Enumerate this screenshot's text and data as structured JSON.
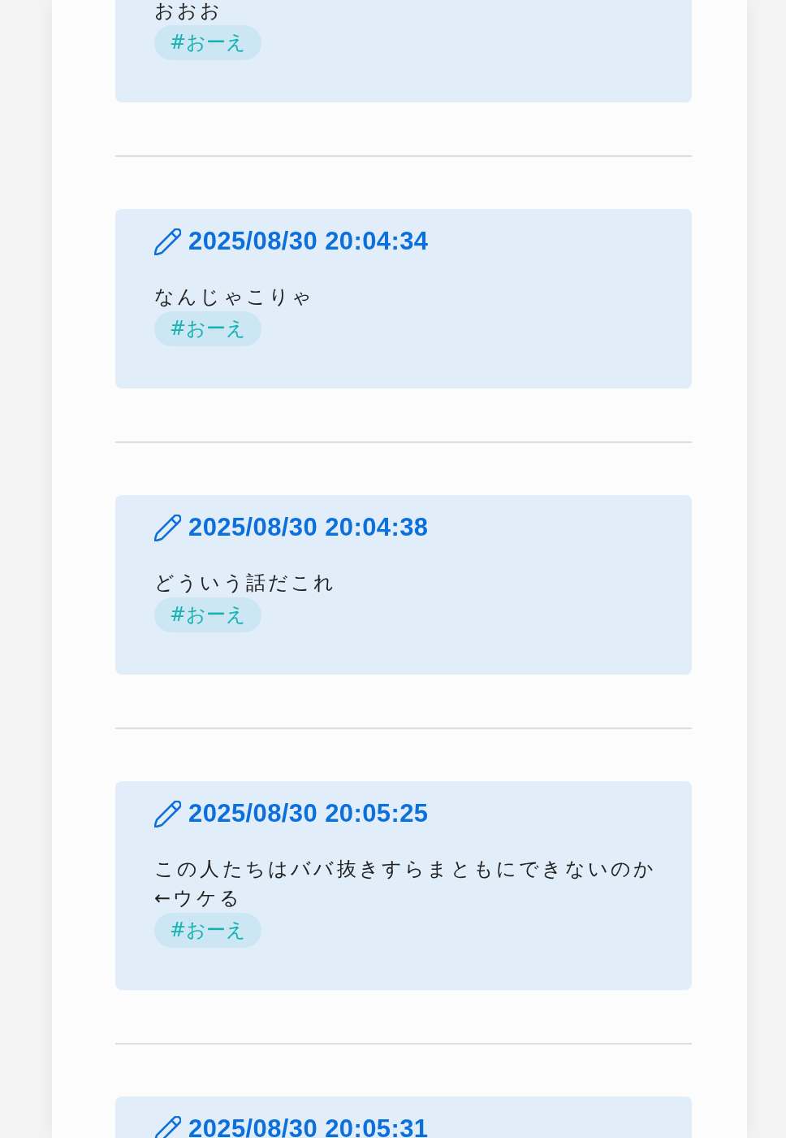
{
  "posts": [
    {
      "body": "おおお",
      "tags": [
        "#おーえ"
      ]
    },
    {
      "date": "2025/08/30 20:04:34",
      "body": "なんじゃこりゃ",
      "tags": [
        "#おーえ"
      ]
    },
    {
      "date": "2025/08/30 20:04:38",
      "body": "どういう話だこれ",
      "tags": [
        "#おーえ"
      ]
    },
    {
      "date": "2025/08/30 20:05:25",
      "body": "この人たちはババ抜きすらまともにできないのか←ウケる",
      "tags": [
        "#おーえ"
      ]
    },
    {
      "date": "2025/08/30 20:05:31"
    }
  ]
}
